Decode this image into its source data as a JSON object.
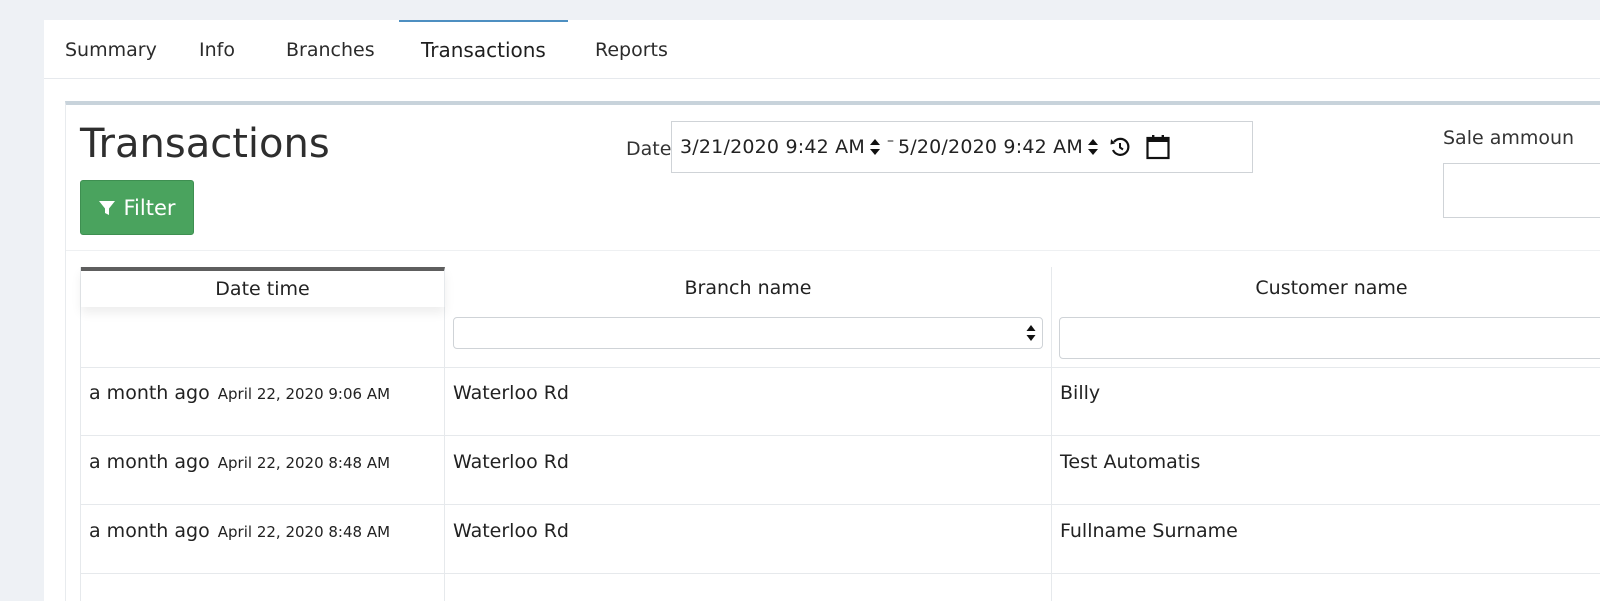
{
  "tabs": [
    {
      "label": "Summary",
      "active": false
    },
    {
      "label": "Info",
      "active": false
    },
    {
      "label": "Branches",
      "active": false
    },
    {
      "label": "Transactions",
      "active": true
    },
    {
      "label": "Reports",
      "active": false
    }
  ],
  "page": {
    "title": "Transactions",
    "filter_label": "Filter"
  },
  "date_filter": {
    "label": "Date",
    "from": "3/21/2020 9:42  AM",
    "separator": "–",
    "to": "5/20/2020 9:42  AM"
  },
  "sale_amount": {
    "label": "Sale ammoun",
    "value": ""
  },
  "table": {
    "columns": [
      "Date time",
      "Branch name",
      "Customer name"
    ],
    "sorted_column": "Date time",
    "branch_filter_value": "",
    "customer_filter_value": "",
    "rows": [
      {
        "relative": "a month ago",
        "absolute": "April 22, 2020 9:06 AM",
        "branch": "Waterloo Rd",
        "customer": "Billy"
      },
      {
        "relative": "a month ago",
        "absolute": "April 22, 2020 8:48 AM",
        "branch": "Waterloo Rd",
        "customer": "Test Automatis"
      },
      {
        "relative": "a month ago",
        "absolute": "April 22, 2020 8:48 AM",
        "branch": "Waterloo Rd",
        "customer": "Fullname Surname"
      }
    ]
  },
  "colors": {
    "active_tab_indicator": "#4d8fc1",
    "filter_button": "#4aa35e",
    "page_background": "#eef1f5"
  },
  "icons": {
    "filter": "funnel-icon",
    "spinner": "up-down-arrows-icon",
    "reset": "reset-history-icon",
    "calendar": "calendar-icon"
  }
}
